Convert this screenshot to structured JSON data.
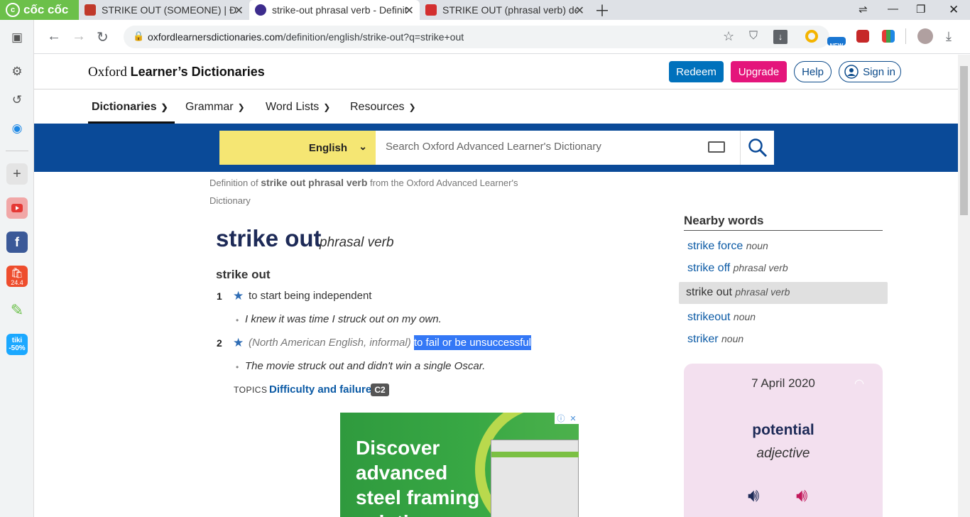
{
  "browser": {
    "brand": "cốc cốc",
    "tabs": [
      {
        "title": "STRIKE OUT (SOMEONE) | Định",
        "active": false
      },
      {
        "title": "strike-out phrasal verb - Definitio",
        "active": true
      },
      {
        "title": "STRIKE OUT (phrasal verb) defi",
        "active": false
      }
    ],
    "new_tab_icon": "plus-icon",
    "url_domain": "oxfordlearnersdictionaries.com",
    "url_path": "/definition/english/strike-out?q=strike+out",
    "extension_new_badge": "NEW"
  },
  "sidebar": {
    "shopee_badge": "24.4",
    "tiki_label": "tiki",
    "tiki_discount": "-50%"
  },
  "site": {
    "logo_prefix": "Oxford ",
    "logo_bold": "Learner’s Dictionaries",
    "redeem": "Redeem",
    "upgrade": "Upgrade",
    "help": "Help",
    "sign_in": "Sign in",
    "menu": [
      "Dictionaries",
      "Grammar",
      "Word Lists",
      "Resources"
    ],
    "language": "English",
    "search_placeholder": "Search Oxford Advanced Learner's Dictionary"
  },
  "entry": {
    "crumb_prefix": "Definition of ",
    "crumb_word": "strike out phrasal verb",
    "crumb_suffix": " from the Oxford Advanced Learner's Dictionary",
    "headword": "strike out",
    "pos": "phrasal verb",
    "phrase": "strike out",
    "senses": [
      {
        "num": "1",
        "grammar": "",
        "definition": "to start being independent",
        "example": "I knew it was time I struck out on my own."
      },
      {
        "num": "2",
        "grammar": "(North American English, informal)",
        "definition": "to fail or be unsuccessful",
        "example": "The movie struck out and didn't win a single Oscar."
      }
    ],
    "topics_label": "TOPICS",
    "topic_link": "Difficulty and failure",
    "cefr": "C2"
  },
  "ad": {
    "text": "Discover\nadvanced\nsteel framing\nsolutions",
    "info_icon": "ⓘ",
    "close_icon": "✕"
  },
  "nearby": {
    "title": "Nearby words",
    "items": [
      {
        "word": "strike force",
        "pos": "noun",
        "selected": false
      },
      {
        "word": "strike off",
        "pos": "phrasal verb",
        "selected": false
      },
      {
        "word": "strike out",
        "pos": "phrasal verb",
        "selected": true
      },
      {
        "word": "strikeout",
        "pos": "noun",
        "selected": false
      },
      {
        "word": "striker",
        "pos": "noun",
        "selected": false
      }
    ]
  },
  "wotd": {
    "date": "7 April 2020",
    "word": "potential",
    "pos": "adjective"
  },
  "colors": {
    "oxford_blue": "#0a4a98",
    "highlight": "#3478f6",
    "redeem": "#0071bc",
    "upgrade": "#e4157b"
  }
}
